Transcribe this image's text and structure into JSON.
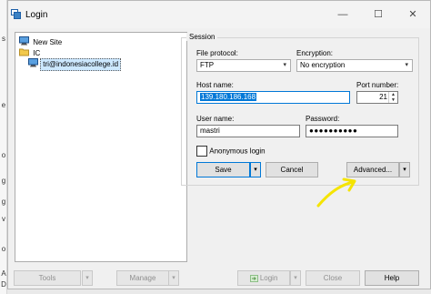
{
  "window": {
    "title": "Login"
  },
  "window_controls": {
    "minimize": "—",
    "maximize": "☐",
    "close": "✕"
  },
  "background_app": {
    "letters": [
      "s",
      "e",
      "o",
      "g",
      "g",
      "v",
      "o",
      "A",
      "D"
    ]
  },
  "site_tree": {
    "items": [
      {
        "label": "New Site",
        "icon": "computer-icon",
        "level": 0
      },
      {
        "label": "IC",
        "icon": "folder-icon",
        "level": 0
      },
      {
        "label": "tri@indonesiacollege.id",
        "icon": "computer-icon",
        "level": 1,
        "selected": true
      }
    ]
  },
  "session": {
    "group_label": "Session",
    "file_protocol": {
      "label": "File protocol:",
      "value": "FTP"
    },
    "encryption": {
      "label": "Encryption:",
      "value": "No encryption"
    },
    "host_name": {
      "label": "Host name:",
      "value": "139.180.186.168"
    },
    "port_number": {
      "label": "Port number:",
      "value": "21"
    },
    "user_name": {
      "label": "User name:",
      "value": "mastri"
    },
    "password": {
      "label": "Password:",
      "value": "●●●●●●●●●●"
    },
    "anonymous_login": {
      "label": "Anonymous login",
      "checked": false
    },
    "buttons": {
      "save": "Save",
      "cancel": "Cancel",
      "advanced": "Advanced..."
    }
  },
  "bottom_buttons": {
    "tools": "Tools",
    "manage": "Manage",
    "login": "Login",
    "close": "Close",
    "help": "Help"
  },
  "icons": {
    "dropdown": "▾",
    "spin_up": "▲",
    "spin_down": "▼"
  },
  "colors": {
    "selection": "#0078d7",
    "arrow": "#f5e400",
    "tree_selected": "#cce8ff"
  }
}
